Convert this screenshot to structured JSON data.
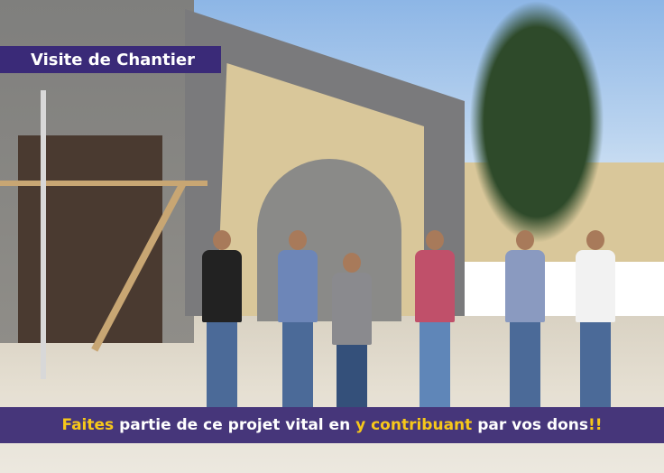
{
  "header_banner": {
    "label": "Visite de Chantier",
    "background": "#3a2a78"
  },
  "footer_banner": {
    "parts": [
      {
        "text": "Faites",
        "highlight": true
      },
      {
        "text": " partie de ce projet vital en ",
        "highlight": false
      },
      {
        "text": "y contribuant",
        "highlight": true
      },
      {
        "text": " par vos dons",
        "highlight": false
      },
      {
        "text": "!!",
        "highlight": true
      }
    ],
    "background": "#46367a",
    "highlight_color": "#f7c81a"
  }
}
